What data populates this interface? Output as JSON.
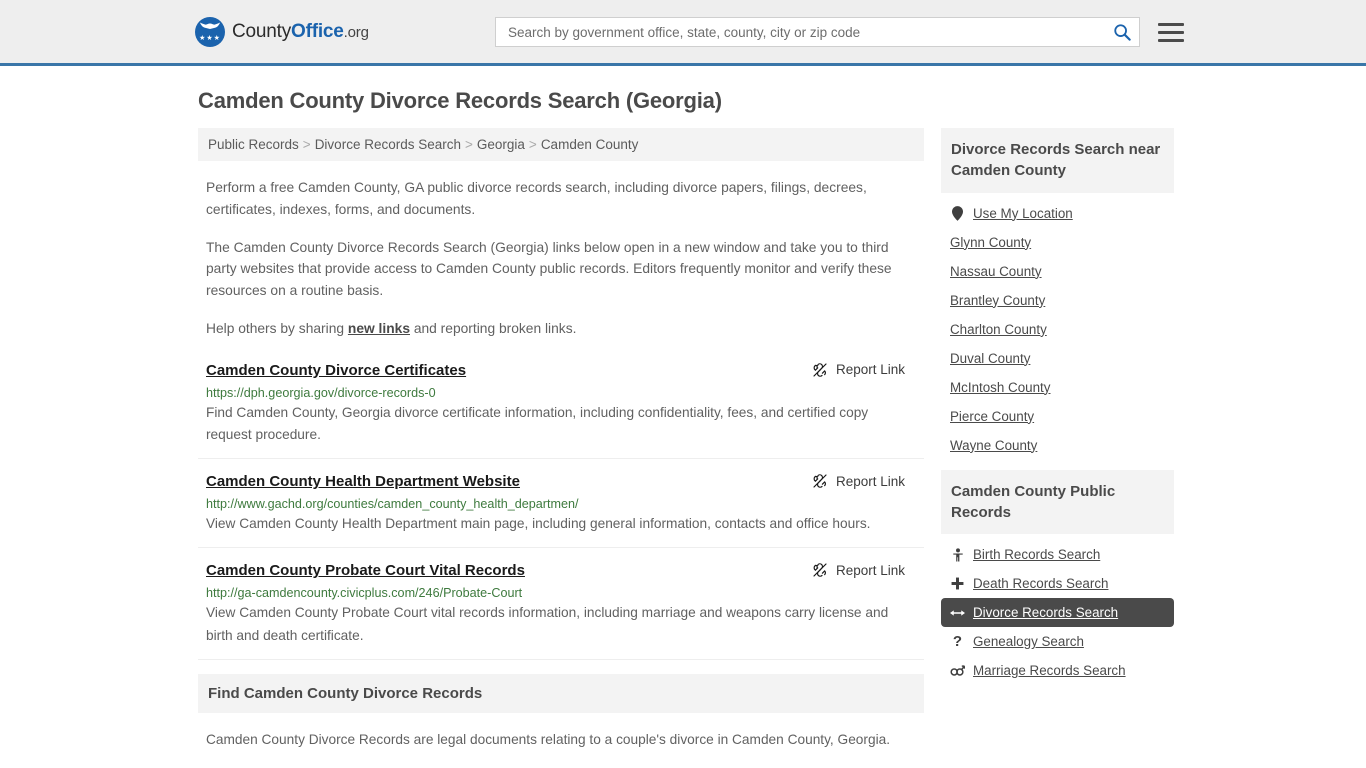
{
  "header": {
    "logo_text_1": "County",
    "logo_text_2": "Office",
    "logo_text_3": ".org",
    "search_placeholder": "Search by government office, state, county, city or zip code",
    "search_value": "",
    "search_icon": "search-icon",
    "menu_icon": "hamburger-menu-icon",
    "accent_color": "#3a76a8",
    "logo_color": "#1b63ad"
  },
  "page": {
    "title": "Camden County Divorce Records Search (Georgia)"
  },
  "breadcrumb": {
    "separator": ">",
    "items": [
      {
        "label": "Public Records"
      },
      {
        "label": "Divorce Records Search"
      },
      {
        "label": "Georgia"
      },
      {
        "label": "Camden County"
      }
    ]
  },
  "intro": {
    "paragraph_1": "Perform a free Camden County, GA public divorce records search, including divorce papers, filings, decrees, certificates, indexes, forms, and documents.",
    "paragraph_2": "The Camden County Divorce Records Search (Georgia) links below open in a new window and take you to third party websites that provide access to Camden County public records. Editors frequently monitor and verify these resources on a routine basis.",
    "paragraph_3_pre": "Help others by sharing ",
    "paragraph_3_link": "new links",
    "paragraph_3_post": " and reporting broken links."
  },
  "results": {
    "report_label": "Report Link",
    "report_icon": "broken-link-icon",
    "url_color": "#3e7a3e",
    "items": [
      {
        "title": "Camden County Divorce Certificates",
        "url": "https://dph.georgia.gov/divorce-records-0",
        "description": "Find Camden County, Georgia divorce certificate information, including confidentiality, fees, and certified copy request procedure."
      },
      {
        "title": "Camden County Health Department Website",
        "url": "http://www.gachd.org/counties/camden_county_health_departmen/",
        "description": "View Camden County Health Department main page, including general information, contacts and office hours."
      },
      {
        "title": "Camden County Probate Court Vital Records",
        "url": "http://ga-camdencounty.civicplus.com/246/Probate-Court",
        "description": "View Camden County Probate Court vital records information, including marriage and weapons carry license and birth and death certificate."
      }
    ]
  },
  "find_section": {
    "heading": "Find Camden County Divorce Records",
    "paragraph": "Camden County Divorce Records are legal documents relating to a couple's divorce in Camden County, Georgia."
  },
  "sidebar": {
    "nearby": {
      "heading": "Divorce Records Search near Camden County",
      "items": [
        {
          "label": "Use My Location",
          "icon": "map-pin-icon",
          "active": false
        },
        {
          "label": "Glynn County",
          "icon": "",
          "active": false
        },
        {
          "label": "Nassau County",
          "icon": "",
          "active": false
        },
        {
          "label": "Brantley County",
          "icon": "",
          "active": false
        },
        {
          "label": "Charlton County",
          "icon": "",
          "active": false
        },
        {
          "label": "Duval County",
          "icon": "",
          "active": false
        },
        {
          "label": "McIntosh County",
          "icon": "",
          "active": false
        },
        {
          "label": "Pierce County",
          "icon": "",
          "active": false
        },
        {
          "label": "Wayne County",
          "icon": "",
          "active": false
        }
      ]
    },
    "public_records": {
      "heading": "Camden County Public Records",
      "active_color": "#4a4a4a",
      "items": [
        {
          "label": "Birth Records Search",
          "icon": "baby-icon",
          "glyph": "Ɣ",
          "active": false
        },
        {
          "label": "Death Records Search",
          "icon": "cross-icon",
          "glyph": "✚",
          "active": false
        },
        {
          "label": "Divorce Records Search",
          "icon": "split-arrows-icon",
          "glyph": "↔",
          "active": true
        },
        {
          "label": "Genealogy Search",
          "icon": "question-mark-icon",
          "glyph": "?",
          "active": false
        },
        {
          "label": "Marriage Records Search",
          "icon": "male-female-icon",
          "glyph": "⚥",
          "active": false
        }
      ]
    }
  }
}
